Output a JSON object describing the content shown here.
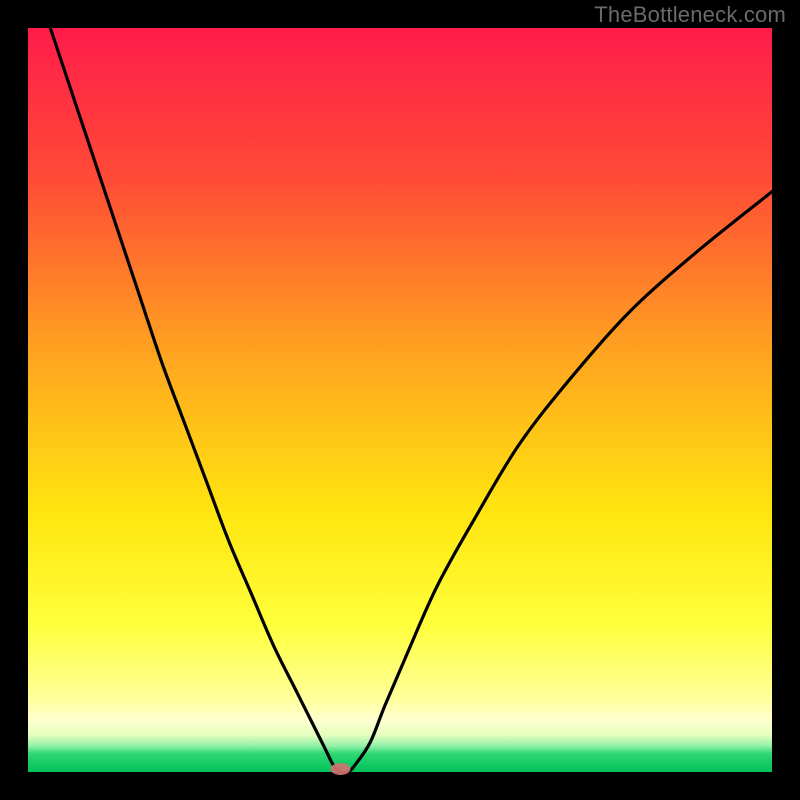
{
  "watermark": "TheBottleneck.com",
  "chart_data": {
    "type": "line",
    "title": "",
    "xlabel": "",
    "ylabel": "",
    "xlim": [
      0,
      100
    ],
    "ylim": [
      0,
      100
    ],
    "background_gradient_stops": [
      {
        "offset": 0.0,
        "color": "#ff1c4b"
      },
      {
        "offset": 0.2,
        "color": "#ff4a36"
      },
      {
        "offset": 0.45,
        "color": "#ffa81f"
      },
      {
        "offset": 0.65,
        "color": "#ffe50f"
      },
      {
        "offset": 0.8,
        "color": "#ffff3a"
      },
      {
        "offset": 0.9,
        "color": "#ffff99"
      },
      {
        "offset": 0.93,
        "color": "#ffffd0"
      },
      {
        "offset": 0.95,
        "color": "#e6ffbe"
      },
      {
        "offset": 0.965,
        "color": "#91f0a8"
      },
      {
        "offset": 0.975,
        "color": "#2fd873"
      },
      {
        "offset": 1.0,
        "color": "#00c05a"
      }
    ],
    "series": [
      {
        "name": "bottleneck-curve",
        "x": [
          3,
          6,
          9,
          12,
          15,
          18,
          21,
          24,
          27,
          30,
          33,
          36,
          38,
          40,
          41,
          42,
          43,
          44,
          46,
          48,
          51,
          55,
          60,
          66,
          73,
          81,
          90,
          100
        ],
        "y": [
          100,
          91,
          82,
          73,
          64,
          55,
          47,
          39,
          31,
          24,
          17,
          11,
          7,
          3,
          1,
          0,
          0,
          1,
          4,
          9,
          16,
          25,
          34,
          44,
          53,
          62,
          70,
          78
        ]
      }
    ],
    "marker": {
      "name": "optimal-point",
      "x": 42,
      "y": 0,
      "color": "#d0736f",
      "rx": 10,
      "ry": 6
    },
    "notes": "y=100 is top (worst, red). y=0 is bottom (best, green). Curve minimum at x≈42."
  }
}
